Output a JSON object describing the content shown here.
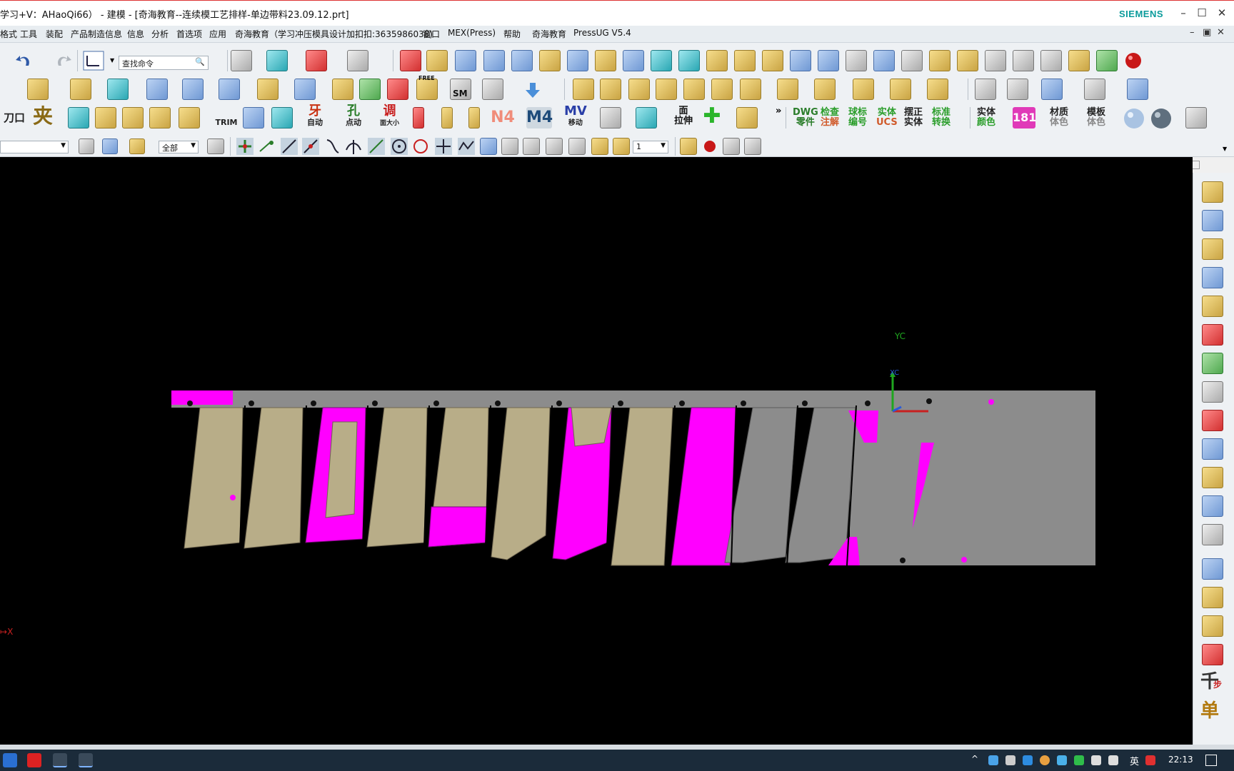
{
  "window": {
    "title": "学习+V：AHaoQi66）  - 建模 - [奇海教育--连续模工艺排样-单边带料23.09.12.prt]",
    "brand": "SIEMENS",
    "controls": [
      "–",
      "☐",
      "✕"
    ]
  },
  "menubar": {
    "items": [
      "格式",
      "工具",
      "装配",
      "产品制造信息",
      "信息",
      "分析",
      "首选项",
      "应用",
      "奇海教育（学习冲压模具设计加扣扣:3635986038)",
      "窗口",
      "MEX(Press)",
      "帮助",
      "奇海教育",
      "PressUG V5.4"
    ],
    "mdi_controls": [
      "–",
      "▣",
      "✕"
    ]
  },
  "toolbar": {
    "search_placeholder": "查找命令",
    "text_buttons": {
      "dao_kou": "刀口",
      "jia": "夹",
      "trim": "TRIM",
      "ya_auto_top": "牙",
      "ya_auto_bottom": "自动",
      "kong_top": "孔",
      "kong_bottom": "点动",
      "tiao_top": "调",
      "tiao_bottom": "面大小",
      "n4": "N4",
      "m4": "M4",
      "mv_top": "MV",
      "mv_bottom": "移动",
      "mian_top": "面",
      "mian_bottom": "拉伸",
      "dwg_top": "DWG",
      "dwg_bottom": "零件",
      "jiancha_top": "检查",
      "jiancha_bottom": "注解",
      "qiubiao_top": "球标",
      "qiubiao_bottom": "编号",
      "shiti_top": "实体",
      "shiti_bottom": "UCS",
      "baizheng_top": "摆正",
      "baizheng_bottom": "实体",
      "biaozhun_top": "标准",
      "biaozhun_bottom": "转换",
      "shiti_color_top": "实体",
      "shiti_color_bottom": "颜色",
      "num_181": "181",
      "caizhi_top": "材质",
      "caizhi_bottom": "体色",
      "muban_top": "模板",
      "muban_bottom": "体色",
      "free": "FREE",
      "sm": "SM",
      "more": "»"
    },
    "filter_select": "全部",
    "layer_select": "1"
  },
  "viewport": {
    "csys_y": "YC",
    "csys_x": "XC",
    "axis_x": "X",
    "colors": {
      "background": "#000000",
      "gold_part": "#b8ad88",
      "magenta": "#ff00ff",
      "strip_grey": "#8c8c8c"
    }
  },
  "rightbar": {
    "text_icons": [
      "千",
      "单"
    ],
    "small_text": "步"
  },
  "taskbar": {
    "clock": "22:13",
    "ime": "英"
  }
}
